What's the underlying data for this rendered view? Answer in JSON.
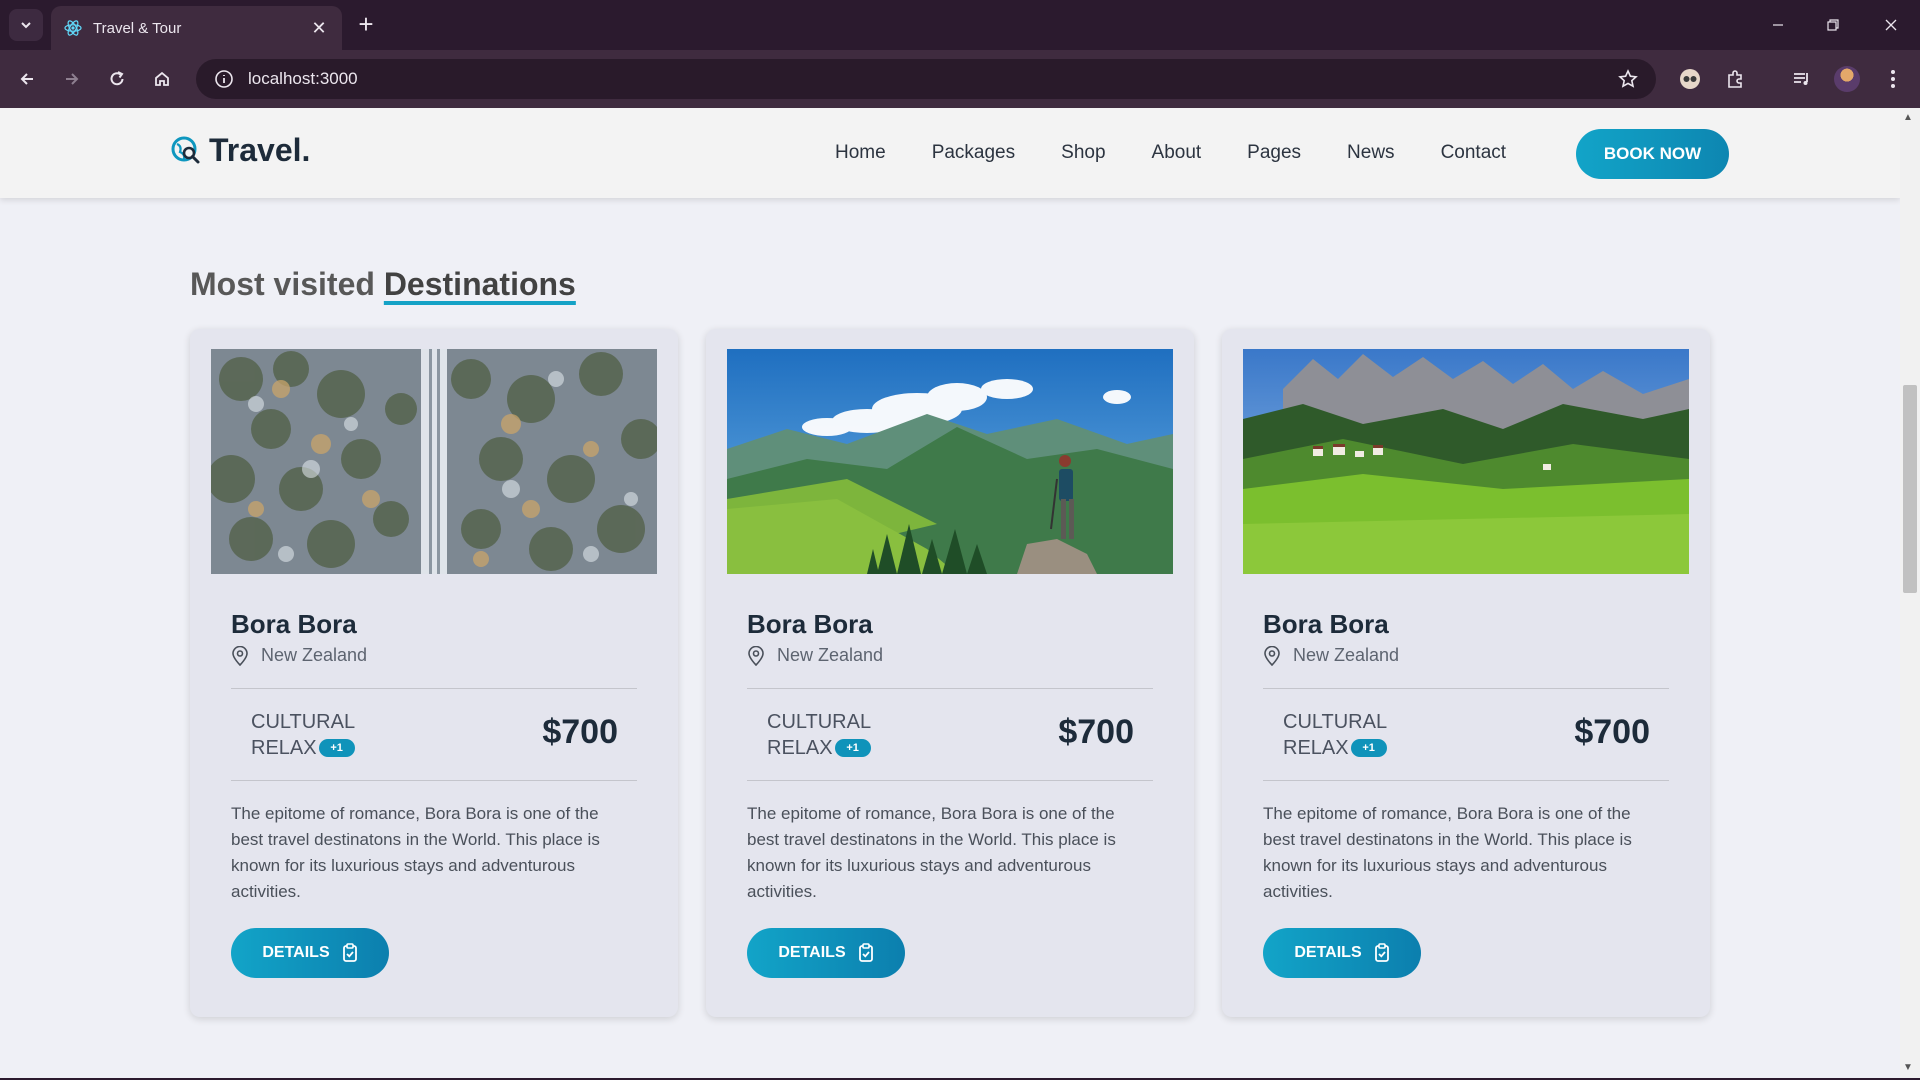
{
  "browser": {
    "tab_title": "Travel & Tour",
    "url": "localhost:3000"
  },
  "navbar": {
    "brand": "Travel.",
    "links": [
      "Home",
      "Packages",
      "Shop",
      "About",
      "Pages",
      "News",
      "Contact"
    ],
    "cta": "BOOK NOW"
  },
  "section": {
    "title_plain": "Most visited",
    "title_highlight": "Destinations"
  },
  "cards": [
    {
      "name": "Bora Bora",
      "location": "New Zealand",
      "tag_line1": "CULTURAL",
      "tag_line2": "RELAX",
      "badge": "+1",
      "price": "$700",
      "description": "The epitome of romance, Bora Bora is one of the best travel destinatons in the World. This place is known for its luxurious stays and adventurous activities.",
      "button": "DETAILS",
      "image": "snowy-forest-road"
    },
    {
      "name": "Bora Bora",
      "location": "New Zealand",
      "tag_line1": "CULTURAL",
      "tag_line2": "RELAX",
      "badge": "+1",
      "price": "$700",
      "description": "The epitome of romance, Bora Bora is one of the best travel destinatons in the World. This place is known for its luxurious stays and adventurous activities.",
      "button": "DETAILS",
      "image": "hiker-on-mountain"
    },
    {
      "name": "Bora Bora",
      "location": "New Zealand",
      "tag_line1": "CULTURAL",
      "tag_line2": "RELAX",
      "badge": "+1",
      "price": "$700",
      "description": "The epitome of romance, Bora Bora is one of the best travel destinatons in the World. This place is known for its luxurious stays and adventurous activities.",
      "button": "DETAILS",
      "image": "alpine-meadow-village"
    }
  ],
  "colors": {
    "accent": "#12a4c8",
    "heading": "#1d2b3a",
    "chrome": "#3f2b3f"
  }
}
